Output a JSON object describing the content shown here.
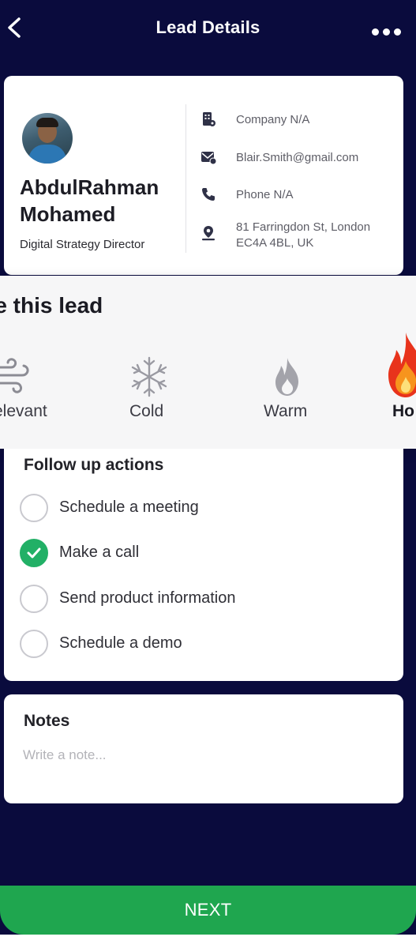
{
  "header": {
    "title": "Lead Details",
    "back_icon": "chevron-left-icon",
    "more_icon": "more-dots-icon"
  },
  "lead": {
    "name_line1": "AbdulRahman",
    "name_line2": "Mohamed",
    "job_title": "Digital Strategy Director",
    "info": [
      {
        "icon": "company-icon",
        "text": "Company N/A"
      },
      {
        "icon": "email-icon",
        "text": "Blair.Smith@gmail.com"
      },
      {
        "icon": "phone-icon",
        "text": "Phone N/A"
      },
      {
        "icon": "location-icon",
        "text": "81 Farringdon St, London EC4A 4BL, UK"
      }
    ]
  },
  "rating": {
    "title": "te this lead",
    "options": [
      {
        "label": "elevant",
        "icon": "wind-icon"
      },
      {
        "label": "Cold",
        "icon": "snowflake-icon"
      },
      {
        "label": "Warm",
        "icon": "flame-outline-icon"
      },
      {
        "label": "Ho",
        "icon": "fire-icon",
        "selected": true
      }
    ]
  },
  "followup": {
    "title": "Follow up actions",
    "items": [
      {
        "label": "Schedule a meeting",
        "checked": false
      },
      {
        "label": "Make a call",
        "checked": true
      },
      {
        "label": "Send product information",
        "checked": false
      },
      {
        "label": "Schedule a demo",
        "checked": false
      }
    ]
  },
  "notes": {
    "title": "Notes",
    "placeholder": "Write a note..."
  },
  "footer": {
    "next_label": "NEXT"
  },
  "colors": {
    "background": "#0a0b3d",
    "accent_green": "#1fa64f",
    "check_green": "#22b066",
    "hot_red": "#e8331c"
  }
}
